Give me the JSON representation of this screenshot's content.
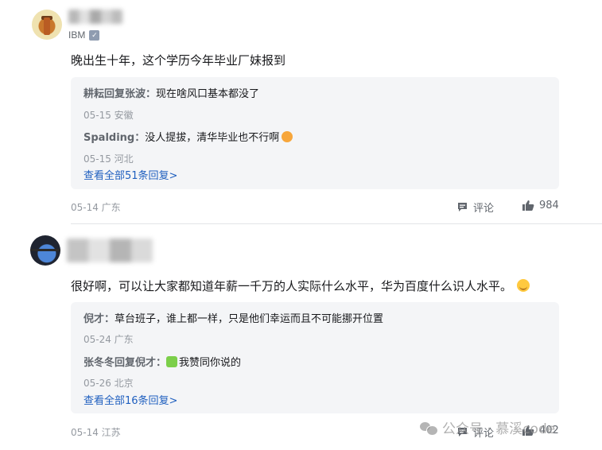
{
  "comments": [
    {
      "org": "IBM",
      "content": "晚出生十年，这个学历今年毕业厂妹报到",
      "replies": [
        {
          "name": "耕耘回复张波：",
          "text": "现在啥风口基本都没了",
          "meta": "05-15 安徽"
        },
        {
          "name": "Spalding：",
          "text": "没人提拔，清华毕业也不行啊",
          "meta": "05-15 河北"
        }
      ],
      "view_all": "查看全部51条回复>",
      "meta": "05-14 广东",
      "comment_label": "评论",
      "likes": "984"
    },
    {
      "content": "很好啊，可以让大家都知道年薪一千万的人实际什么水平，华为百度什么识人水平。",
      "replies": [
        {
          "name": "倪才：",
          "text": "草台班子，谁上都一样，只是他们幸运而且不可能挪开位置",
          "meta": "05-24 广东"
        },
        {
          "name": "张冬冬回复倪才：",
          "text": "我赞同你说的",
          "meta": "05-26 北京"
        }
      ],
      "view_all": "查看全部16条回复>",
      "meta": "05-14 江苏",
      "comment_label": "评论",
      "likes": "402"
    }
  ],
  "watermark": "公众号 · 慕溪code",
  "icons": {
    "verify": "verified-badge-icon",
    "comment": "comment-bubble-icon",
    "like": "thumbs-up-icon",
    "wechat": "wechat-icon"
  }
}
